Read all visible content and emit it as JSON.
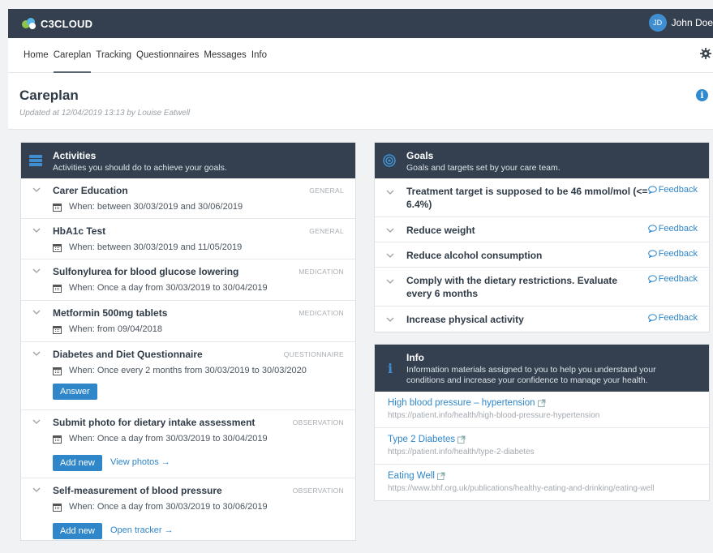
{
  "app": {
    "logo_text": "C3CLOUD"
  },
  "user": {
    "initials": "JD",
    "name": "John Doe"
  },
  "nav": [
    "Home",
    "Careplan",
    "Tracking",
    "Questionnaires",
    "Messages",
    "Info"
  ],
  "page": {
    "title": "Careplan",
    "updated": "Updated at 12/04/2019 13:13 by Louise Eatwell"
  },
  "activities": {
    "title": "Activities",
    "subtitle": "Activities you should do to achieve your goals.",
    "items": [
      {
        "title": "Carer Education",
        "tag": "GENERAL",
        "when": "When: between 30/03/2019 and 30/06/2019"
      },
      {
        "title": "HbA1c Test",
        "tag": "GENERAL",
        "when": "When: between 30/03/2019 and 11/05/2019"
      },
      {
        "title": "Sulfonylurea for blood glucose lowering",
        "tag": "MEDICATION",
        "when": "When: Once a day from 30/03/2019 to 30/04/2019"
      },
      {
        "title": "Metformin 500mg tablets",
        "tag": "MEDICATION",
        "when": "When: from 09/04/2018"
      },
      {
        "title": "Diabetes and Diet Questionnaire",
        "tag": "QUESTIONNAIRE",
        "when": "When: Once every 2 months from 30/03/2019 to 30/03/2020",
        "button": "Answer"
      },
      {
        "title": "Submit photo for dietary intake assessment",
        "tag": "OBSERVATION",
        "when": "When: Once a day from 30/03/2019 to 30/04/2019",
        "button": "Add new",
        "link": "View photos →"
      },
      {
        "title": "Self-measurement of blood pressure",
        "tag": "OBSERVATION",
        "when": "When: Once a day from 30/03/2019 to 30/06/2019",
        "button": "Add new",
        "link": "Open tracker →"
      }
    ]
  },
  "goals": {
    "title": "Goals",
    "subtitle": "Goals and targets set by your care team.",
    "feedback_label": "Feedback",
    "items": [
      "Treatment target is supposed to be 46 mmol/mol (<= 6.4%)",
      "Reduce weight",
      "Reduce alcohol consumption",
      "Comply with the dietary restrictions. Evaluate every 6 months",
      "Increase physical activity"
    ]
  },
  "info": {
    "title": "Info",
    "subtitle": "Information materials assigned to you to help you understand your conditions and increase your confidence to manage your health.",
    "items": [
      {
        "title": "High blood pressure – hypertension",
        "url": "https://patient.info/health/high-blood-pressure-hypertension"
      },
      {
        "title": "Type 2 Diabetes",
        "url": "https://patient.info/health/type-2-diabetes"
      },
      {
        "title": "Eating Well",
        "url": "https://www.bhf.org.uk/publications/healthy-eating-and-drinking/eating-well"
      }
    ]
  },
  "colors": {
    "header_bg": "#34404f",
    "accent": "#2f86c9",
    "page_bg": "#f1f2f3"
  }
}
